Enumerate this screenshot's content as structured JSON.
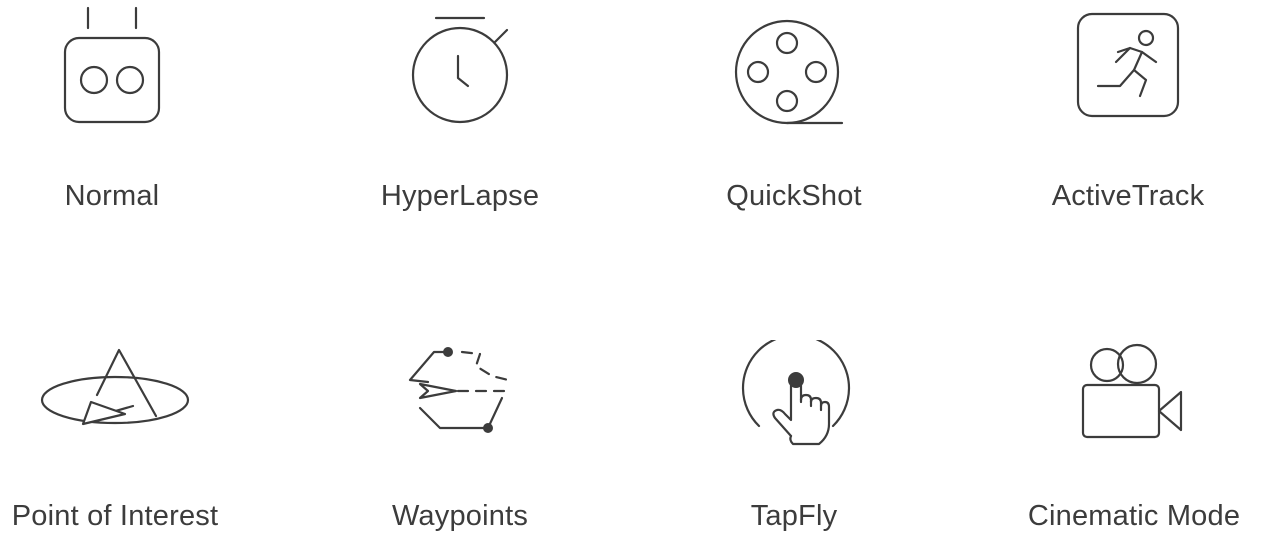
{
  "modes": [
    {
      "label": "Normal",
      "icon": "remote-controller-icon"
    },
    {
      "label": "HyperLapse",
      "icon": "stopwatch-icon"
    },
    {
      "label": "QuickShot",
      "icon": "film-reel-icon"
    },
    {
      "label": "ActiveTrack",
      "icon": "running-person-icon"
    },
    {
      "label": "Point of Interest",
      "icon": "orbit-icon"
    },
    {
      "label": "Waypoints",
      "icon": "waypoints-path-icon"
    },
    {
      "label": "TapFly",
      "icon": "tap-finger-icon"
    },
    {
      "label": "Cinematic Mode",
      "icon": "movie-camera-icon"
    }
  ],
  "colors": {
    "icon_stroke": "#3c3c3c",
    "text": "#3c3c3c",
    "background": "#ffffff"
  }
}
